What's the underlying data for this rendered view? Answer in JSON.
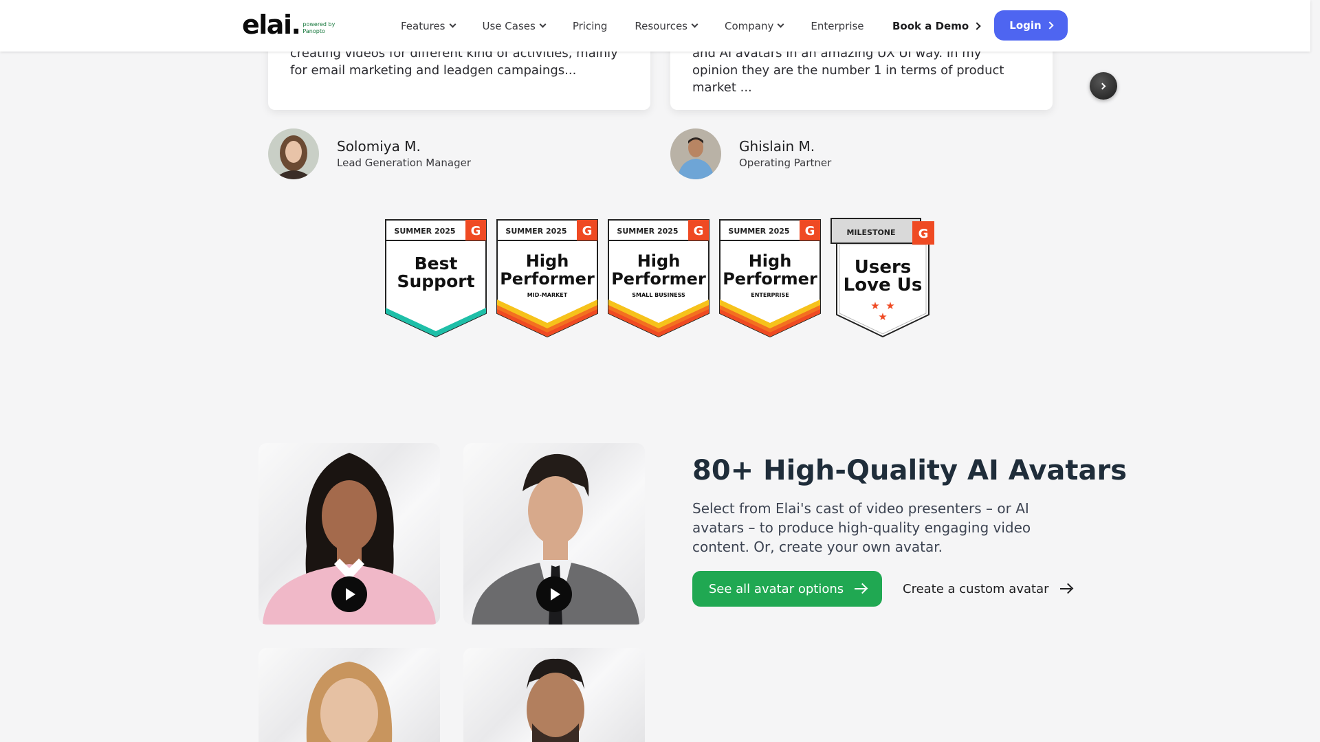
{
  "header": {
    "logo_text": "elai.",
    "logo_powered_line1": "powered by",
    "logo_powered_line2": "Panopto",
    "nav": [
      {
        "label": "Features",
        "has_dropdown": true
      },
      {
        "label": "Use Cases",
        "has_dropdown": true
      },
      {
        "label": "Pricing",
        "has_dropdown": false
      },
      {
        "label": "Resources",
        "has_dropdown": true
      },
      {
        "label": "Company",
        "has_dropdown": true
      },
      {
        "label": "Enterprise",
        "has_dropdown": false
      }
    ],
    "book_demo": "Book a Demo",
    "login": "Login",
    "login_color": "#4e65f1"
  },
  "testimonials": [
    {
      "text": "creating videos for different kind of activities, mainly for email marketing and leadgen campaings...",
      "name": "Solomiya M.",
      "role": "Lead Generation Manager"
    },
    {
      "text": "and AI avatars in an amazing UX UI way. In my opinion they are the number 1 in terms of product market ...",
      "name": "Ghislain M.",
      "role": "Operating Partner"
    }
  ],
  "badges": [
    {
      "header": "SUMMER 2025",
      "line1": "Best",
      "line2": "Support",
      "sub": ""
    },
    {
      "header": "SUMMER 2025",
      "line1": "High",
      "line2": "Performer",
      "sub": "MID-MARKET"
    },
    {
      "header": "SUMMER 2025",
      "line1": "High",
      "line2": "Performer",
      "sub": "SMALL BUSINESS"
    },
    {
      "header": "SUMMER 2025",
      "line1": "High",
      "line2": "Performer",
      "sub": "ENTERPRISE"
    },
    {
      "header": "MILESTONE",
      "line1": "Users",
      "line2": "Love Us",
      "sub": ""
    }
  ],
  "avatars_section": {
    "title": "80+ High-Quality AI Avatars",
    "description": "Select from Elai's cast of video presenters – or AI avatars – to produce high-quality engaging video content. Or, create your own avatar.",
    "primary_button": "See all avatar options",
    "secondary_link": "Create a custom avatar",
    "primary_color": "#20a852"
  }
}
